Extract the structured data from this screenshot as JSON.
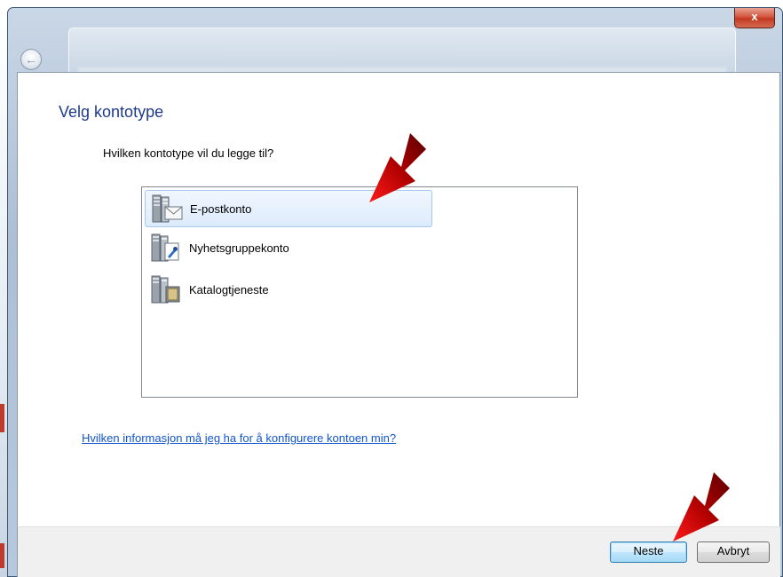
{
  "dialog": {
    "heading": "Velg kontotype",
    "question": "Hvilken kontotype vil du legge til?",
    "help_link": "Hvilken informasjon må jeg ha for å konfigurere kontoen min?",
    "close_label": "x"
  },
  "account_types": [
    {
      "label": "E-postkonto",
      "selected": true,
      "icon": "email-server-icon"
    },
    {
      "label": "Nyhetsgruppekonto",
      "selected": false,
      "icon": "newsgroup-server-icon"
    },
    {
      "label": "Katalogtjeneste",
      "selected": false,
      "icon": "directory-server-icon"
    }
  ],
  "buttons": {
    "next": "Neste",
    "cancel": "Avbryt"
  },
  "colors": {
    "heading": "#1e3a8a",
    "link": "#1155cc",
    "annotation_arrow": "#e00000"
  }
}
